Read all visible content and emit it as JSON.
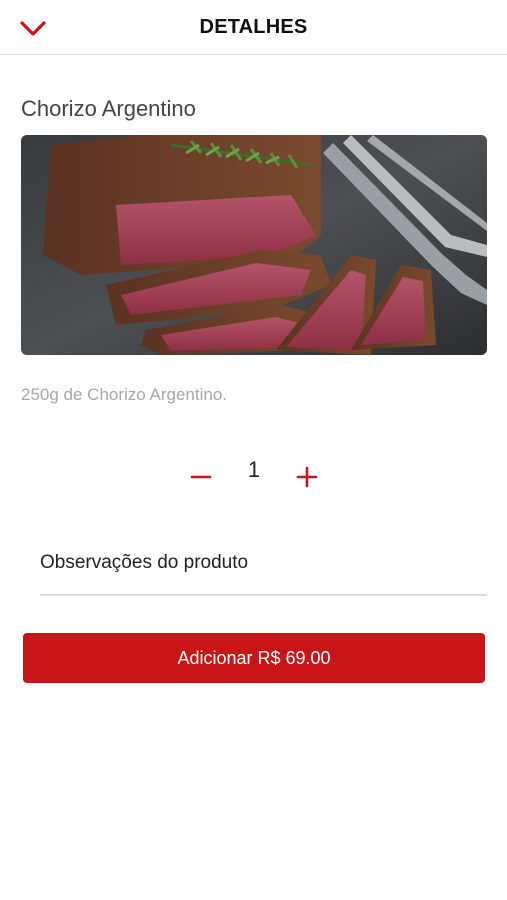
{
  "header": {
    "title": "DETALHES",
    "back_icon": "chevron-down-icon"
  },
  "product": {
    "name": "Chorizo Argentino",
    "image_subject": "sliced grilled steak with fork",
    "description": "250g de Chorizo Argentino."
  },
  "quantity": {
    "minus_icon": "minus-icon",
    "value": "1",
    "plus_icon": "plus-icon"
  },
  "notes": {
    "placeholder": "Observações do produto"
  },
  "add_button": {
    "label": "Adicionar R$ 69.00"
  },
  "colors": {
    "accent": "#c91518",
    "muted_text": "#a8a8a8",
    "divider": "#e3e3e3"
  }
}
